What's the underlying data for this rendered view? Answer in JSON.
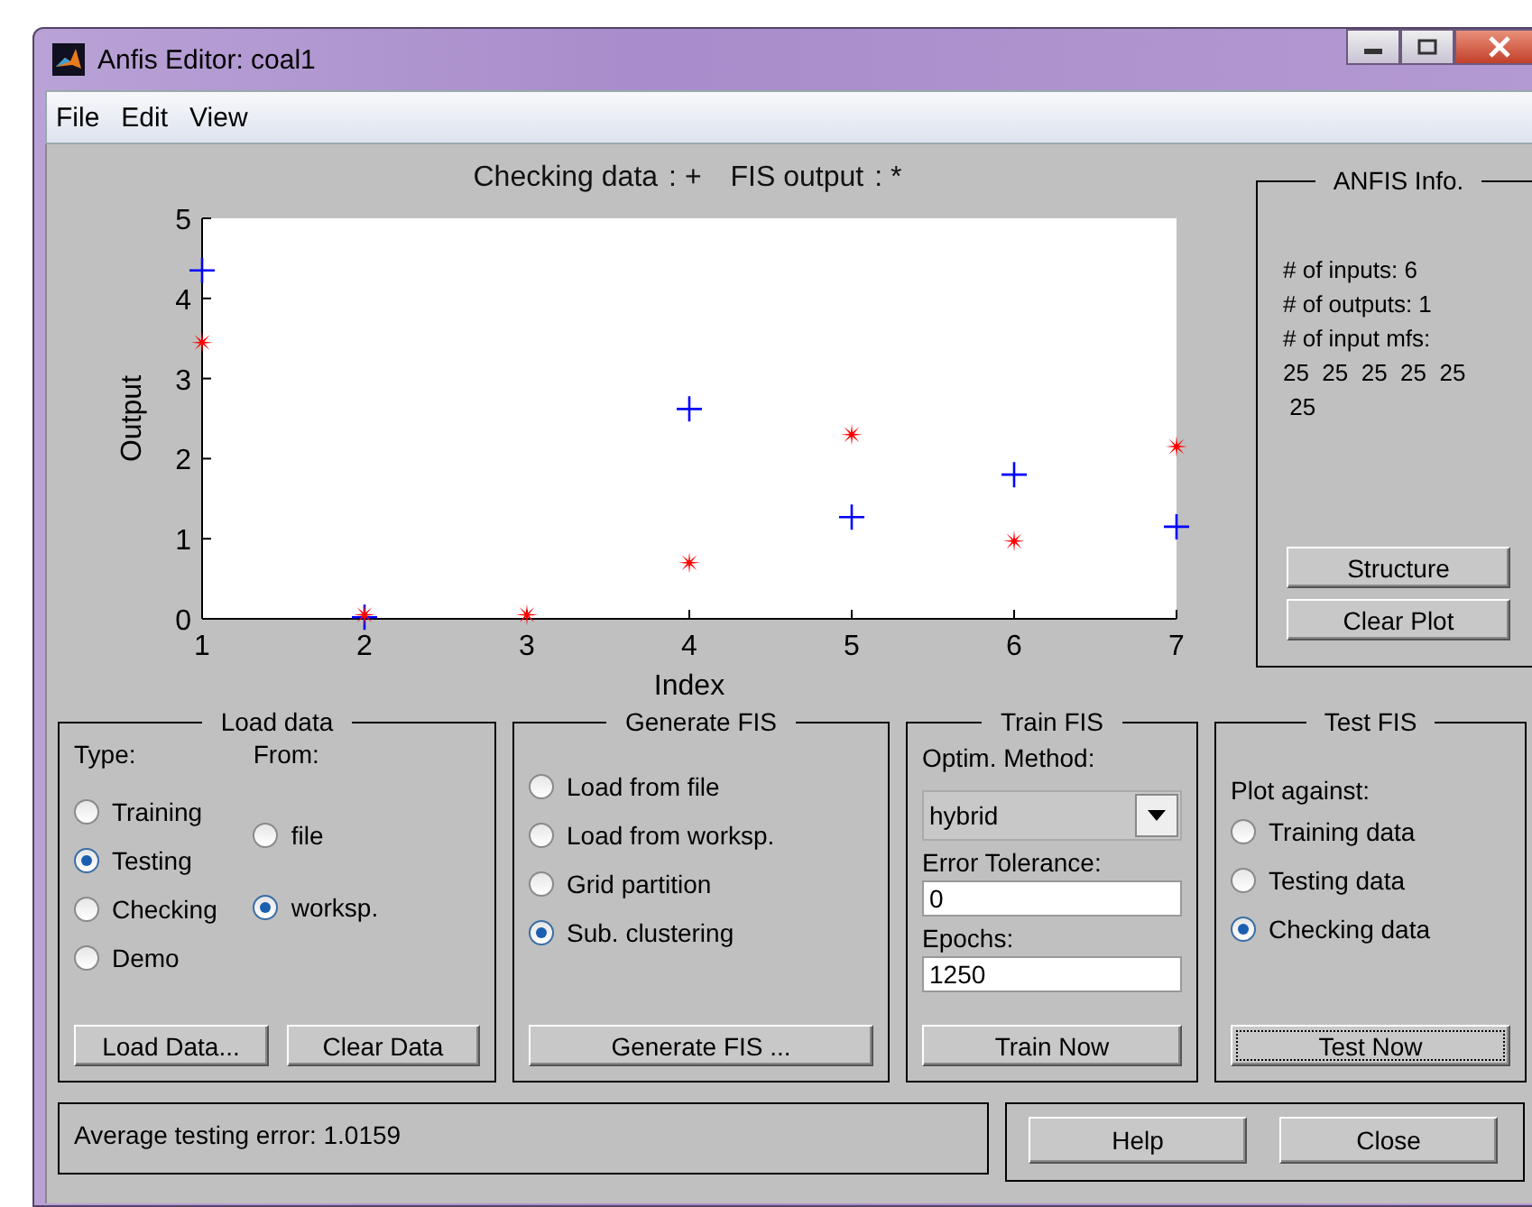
{
  "window": {
    "title": "Anfis Editor: coal1"
  },
  "menu": [
    "File",
    "Edit",
    "View"
  ],
  "plot": {
    "legend_symbols": [
      ": +",
      ": *"
    ],
    "chart_data": {
      "type": "scatter",
      "xlabel": "Index",
      "ylabel": "Output",
      "x": [
        1,
        2,
        3,
        4,
        5,
        6,
        7
      ],
      "series": [
        {
          "name": "Checking data",
          "marker": "cross",
          "color": "#0000ff",
          "values": [
            4.35,
            0.02,
            null,
            2.62,
            1.27,
            1.8,
            1.15
          ]
        },
        {
          "name": "FIS output",
          "marker": "star",
          "color": "#ff0000",
          "values": [
            3.45,
            0.05,
            0.05,
            0.7,
            2.3,
            0.97,
            2.15
          ]
        }
      ],
      "xlim": [
        1,
        7
      ],
      "ylim": [
        0,
        5
      ],
      "xticks": [
        1,
        2,
        3,
        4,
        5,
        6,
        7
      ],
      "yticks": [
        0,
        1,
        2,
        3,
        4,
        5
      ]
    }
  },
  "info": {
    "title": "ANFIS Info.",
    "lines": [
      "# of inputs: 6",
      "# of outputs: 1",
      "# of input mfs:",
      "25  25  25  25  25",
      " 25"
    ],
    "buttons": [
      "Structure",
      "Clear Plot"
    ]
  },
  "load_data": {
    "title": "Load data",
    "type_label": "Type:",
    "types": [
      {
        "label": "Training",
        "selected": false
      },
      {
        "label": "Testing",
        "selected": true
      },
      {
        "label": "Checking",
        "selected": false
      },
      {
        "label": "Demo",
        "selected": false
      }
    ],
    "from_label": "From:",
    "sources": [
      {
        "label": "file",
        "selected": false
      },
      {
        "label": "worksp.",
        "selected": true
      }
    ],
    "buttons": [
      "Load Data...",
      "Clear Data"
    ]
  },
  "generate_fis": {
    "title": "Generate FIS",
    "options": [
      {
        "label": "Load from file",
        "selected": false
      },
      {
        "label": "Load from worksp.",
        "selected": false
      },
      {
        "label": "Grid partition",
        "selected": false
      },
      {
        "label": "Sub. clustering",
        "selected": true
      }
    ],
    "button": "Generate FIS ..."
  },
  "train_fis": {
    "title": "Train FIS",
    "method_label": "Optim. Method:",
    "method": "hybrid",
    "tolerance_label": "Error Tolerance:",
    "tolerance": "0",
    "epochs_label": "Epochs:",
    "epochs": "1250",
    "button": "Train Now"
  },
  "test_fis": {
    "title": "Test FIS",
    "plot_label": "Plot against:",
    "options": [
      {
        "label": "Training data",
        "selected": false
      },
      {
        "label": "Testing data",
        "selected": false
      },
      {
        "label": "Checking data",
        "selected": true
      }
    ],
    "button": "Test Now",
    "button_focused": true
  },
  "status": "Average testing error: 1.0159",
  "buttons": [
    "Help",
    "Close"
  ]
}
